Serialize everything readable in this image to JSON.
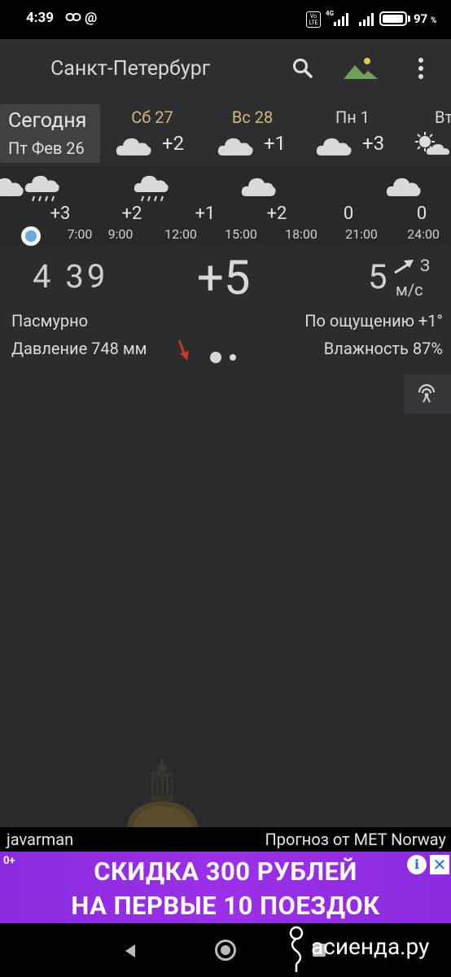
{
  "status_bar": {
    "time": "4:39",
    "at_symbol": "@",
    "network": "4G",
    "volte": "Vo LTE",
    "battery_percent": "97",
    "battery_unit": "%",
    "battery_level": 0.97
  },
  "app_bar": {
    "city": "Санкт-Петербург",
    "icons": [
      "search-icon",
      "mountain-landscape-icon",
      "more-vert-icon"
    ]
  },
  "days": {
    "today": {
      "label": "Сегодня",
      "date": "Пт Фев 26"
    },
    "list": [
      {
        "name": "Сб 27",
        "temp": "+2",
        "icon": "cloud-icon",
        "weekend": true
      },
      {
        "name": "Вс 28",
        "temp": "+1",
        "icon": "cloud-icon",
        "weekend": true
      },
      {
        "name": "Пн 1",
        "temp": "+3",
        "icon": "cloud-icon",
        "weekend": false
      },
      {
        "name": "Вт",
        "temp": "",
        "icon": "sun-cloud-icon",
        "weekend": false
      }
    ]
  },
  "hourly": [
    {
      "time": "7:00",
      "temp": "+3",
      "icon": "cloud-rain-icon"
    },
    {
      "time": "9:00",
      "temp": "+2",
      "icon": ""
    },
    {
      "time": "12:00",
      "temp": "+1",
      "icon": "cloud-rain-icon"
    },
    {
      "time": "15:00",
      "temp": "+2",
      "icon": "cloud-icon"
    },
    {
      "time": "18:00",
      "temp": "0",
      "icon": ""
    },
    {
      "time": "21:00",
      "temp": "0",
      "icon": "cloud-icon"
    },
    {
      "time": "24:00",
      "temp": "",
      "icon": ""
    }
  ],
  "current": {
    "time": "4 39",
    "temp": "+5",
    "wind_speed": "5",
    "wind_dir": "З",
    "wind_unit": "м/с",
    "condition": "Пасмурно",
    "feels_like": "По ощущению +1°",
    "pressure": "Давление 748 мм",
    "humidity": "Влажность 87%"
  },
  "credits": {
    "photo_author": "javarman",
    "source": "Прогноз от MET Norway"
  },
  "ad": {
    "age": "0+",
    "line1": "СКИДКА 300 РУБЛЕЙ",
    "line2": "НА ПЕРВЫЕ 10 ПОЕЗДОК",
    "info": "i",
    "close": "✕",
    "color": "#8b2ae0"
  },
  "watermark": "асиенда.ру"
}
